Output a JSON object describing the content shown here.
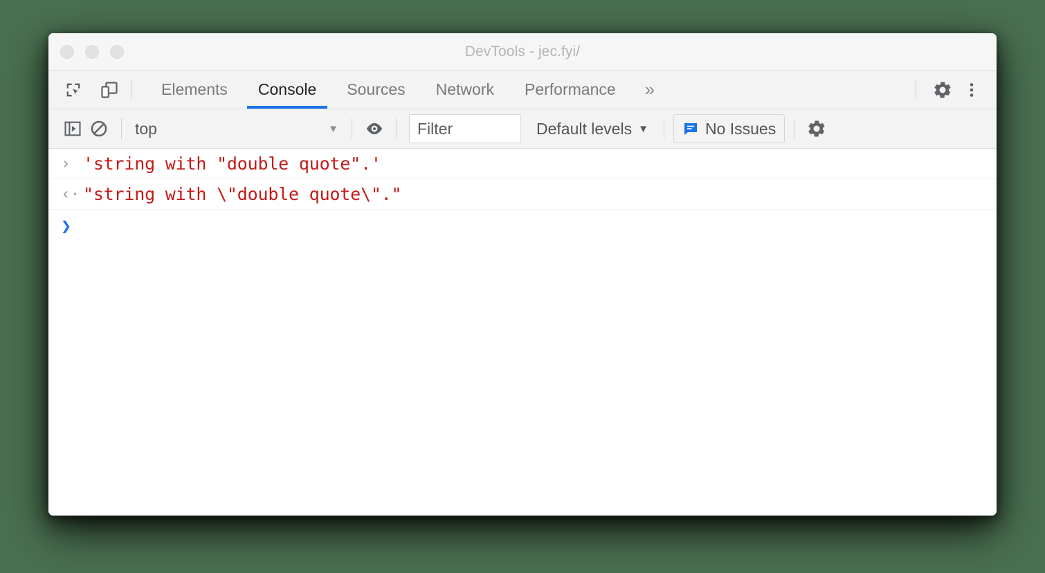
{
  "window": {
    "title": "DevTools - jec.fyi/",
    "traffic_lights": [
      "close",
      "minimize",
      "maximize"
    ]
  },
  "tabbar": {
    "inspect_icon": "inspect-element-icon",
    "device_icon": "device-toolbar-icon",
    "tabs": [
      {
        "label": "Elements",
        "active": false
      },
      {
        "label": "Console",
        "active": true
      },
      {
        "label": "Sources",
        "active": false
      },
      {
        "label": "Network",
        "active": false
      },
      {
        "label": "Performance",
        "active": false
      }
    ],
    "more_tabs_label": "»",
    "settings_icon": "gear-icon",
    "more_options_icon": "kebab-menu-icon"
  },
  "console_toolbar": {
    "sidebar_toggle_icon": "console-sidebar-icon",
    "clear_console_icon": "clear-console-icon",
    "context": {
      "selected": "top",
      "caret": "▼"
    },
    "live_expression_icon": "eye-icon",
    "filter": {
      "value": "",
      "placeholder": "Filter"
    },
    "levels": {
      "label": "Default levels",
      "caret": "▼"
    },
    "issues": {
      "label": "No Issues",
      "icon": "issues-bubble-icon",
      "icon_color": "#1a73e8"
    },
    "settings_icon": "console-settings-gear-icon"
  },
  "console": {
    "rows": [
      {
        "gutter": "›",
        "kind": "input",
        "text": "'string with \"double quote\".'"
      },
      {
        "gutter": "‹·",
        "kind": "output",
        "text": "\"string with \\\"double quote\\\".\""
      }
    ],
    "prompt": {
      "caret": "❯",
      "value": ""
    },
    "string_color": "#c41a16",
    "prompt_color": "#1a73e8"
  },
  "theme": {
    "desktop_background": "#4a7050",
    "accent": "#1a73e8",
    "toolbar_background": "#f3f3f3",
    "titlebar_background": "#f6f6f6"
  }
}
